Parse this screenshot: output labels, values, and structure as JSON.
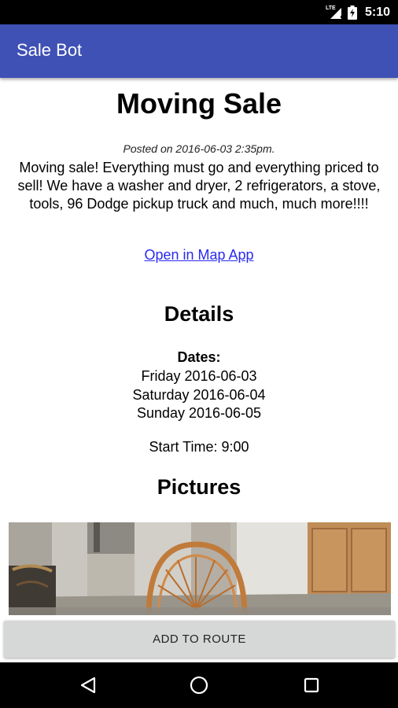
{
  "status_bar": {
    "time": "5:10",
    "network": "LTE"
  },
  "app_bar": {
    "title": "Sale Bot"
  },
  "sale": {
    "title": "Moving Sale",
    "posted": "Posted on 2016-06-03 2:35pm.",
    "description": "Moving sale! Everything must go and everything priced to sell! We have a washer and dryer, 2 refrigerators, a stove, tools, 96 Dodge pickup truck and much, much more!!!!",
    "map_link": "Open in Map App"
  },
  "details": {
    "heading": "Details",
    "dates_label": "Dates:",
    "dates": [
      "Friday 2016-06-03",
      "Saturday 2016-06-04",
      "Sunday 2016-06-05"
    ],
    "start_time": "Start Time: 9:00"
  },
  "pictures": {
    "heading": "Pictures"
  },
  "actions": {
    "add_to_route": "ADD TO ROUTE"
  },
  "icons": {
    "signal": "signal-icon",
    "battery": "battery-charging-icon",
    "back": "back-icon",
    "home": "home-icon",
    "recents": "recents-icon"
  }
}
